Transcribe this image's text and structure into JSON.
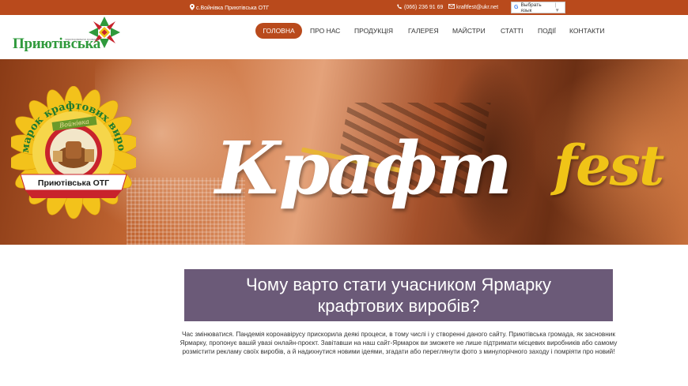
{
  "topbar": {
    "address": "с.Войнівка Приютівська ОТГ",
    "phone": "(066) 236 91 69",
    "email": "kraftfest@ukr.net",
    "language_label": "Выбрать язык",
    "address_icon": "map-pin-icon",
    "phone_icon": "phone-icon",
    "email_icon": "envelope-icon",
    "language_icon": "google-translate-icon"
  },
  "logo": {
    "name": "Приютівська",
    "subtitle": "територіальна громада"
  },
  "nav": {
    "items": [
      {
        "label": "ГОЛОВНА",
        "active": true
      },
      {
        "label": "ПРО НАС",
        "active": false
      },
      {
        "label": "ПРОДУКЦІЯ",
        "active": false
      },
      {
        "label": "ГАЛЕРЕЯ",
        "active": false
      },
      {
        "label": "МАЙСТРИ",
        "active": false
      },
      {
        "label": "СТАТТІ",
        "active": false
      },
      {
        "label": "ПОДІЇ",
        "active": false
      },
      {
        "label": "КОНТАКТИ",
        "active": false
      }
    ]
  },
  "hero": {
    "title_main": "Крафт",
    "title_accent": "fest",
    "badge_arc_text": "Ярмарок крафтових виробів",
    "badge_ribbon_text": "Приютівська ОТГ",
    "badge_banner_text": "Войнівка"
  },
  "content": {
    "heading_line1": "Чому варто стати учасником Ярмарку",
    "heading_line2": "крафтових виробів?",
    "paragraph": "Час змінюватися. Пандемія коронавірусу прискорила деякі процеси, в тому числі і у створенні даного сайту. Приютівська громада, як засновник Ярмарку, пропонує вашій увазі онлайн-проєкт. Завітавши на наш сайт-Ярмарок ви зможете не лише підтримати місцевих виробників або самому розмістити рекламу своїх виробів, а й надихнутися новими ідеями, згадати або переглянути фото з минулорічного заходу і помріяти про новий!"
  },
  "colors": {
    "brand": "#b94a1c",
    "logo_green": "#2f9a3c",
    "heading_bg": "#6b5a78",
    "fest_yellow": "#f0c417"
  }
}
